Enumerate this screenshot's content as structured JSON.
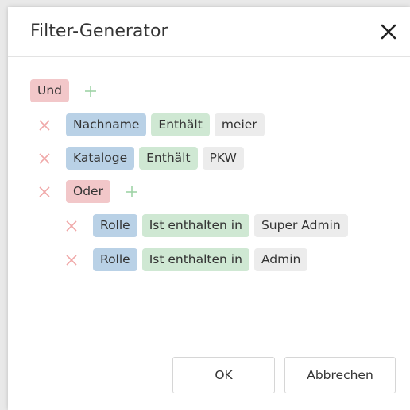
{
  "dialog": {
    "title": "Filter-Generator"
  },
  "filter": {
    "root_logic": "Und",
    "conditions": [
      {
        "field": "Nachname",
        "operator": "Enthält",
        "value": "meier"
      },
      {
        "field": "Kataloge",
        "operator": "Enthält",
        "value": "PKW"
      }
    ],
    "group": {
      "logic": "Oder",
      "conditions": [
        {
          "field": "Rolle",
          "operator": "Ist enthalten in",
          "value": "Super Admin"
        },
        {
          "field": "Rolle",
          "operator": "Ist enthalten in",
          "value": "Admin"
        }
      ]
    }
  },
  "footer": {
    "ok_label": "OK",
    "cancel_label": "Abbrechen"
  },
  "colors": {
    "logic_chip": "#f2c7c9",
    "field_chip": "#b9d1e6",
    "operator_chip": "#cfe8d3",
    "value_chip": "#ececec",
    "remove_icon": "#f0a8a8",
    "add_icon": "#9fd3a6"
  },
  "icons": {
    "close": "close-icon",
    "remove": "remove-icon",
    "add": "plus-icon"
  }
}
